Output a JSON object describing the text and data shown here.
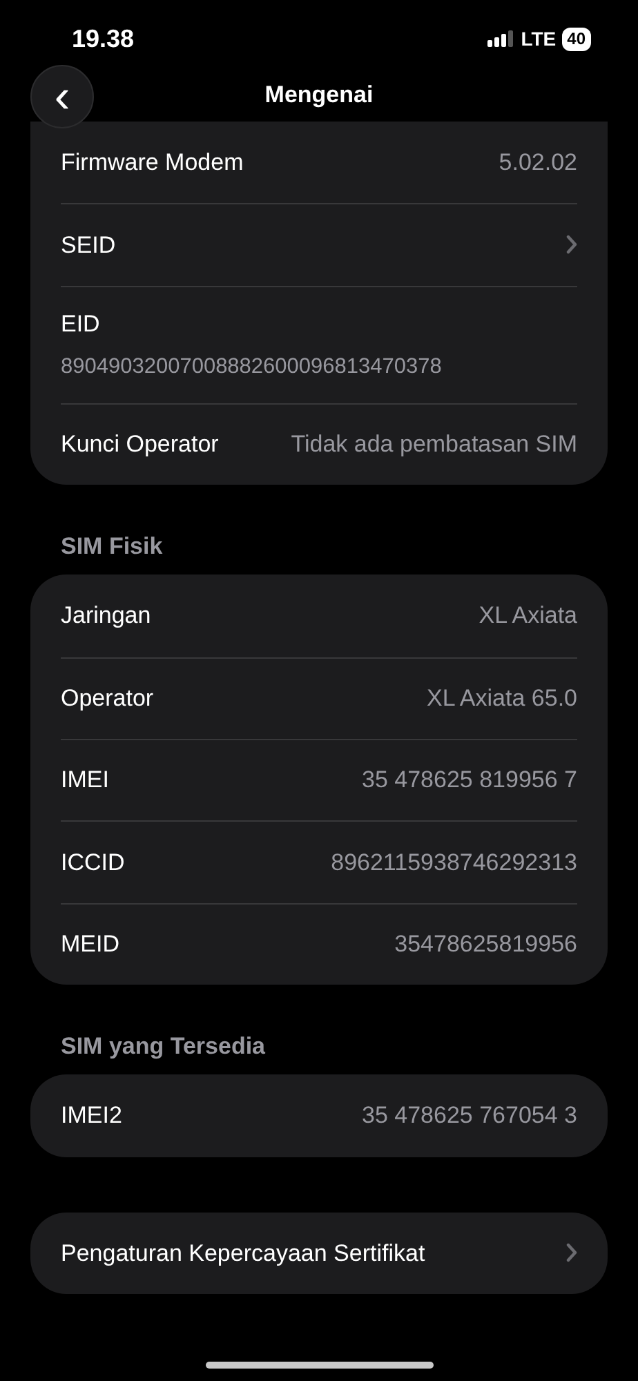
{
  "status_bar": {
    "time": "19.38",
    "network": "LTE",
    "battery": "40"
  },
  "nav": {
    "back": "‹",
    "title": "Mengenai"
  },
  "sections": [
    {
      "clipped_top": true,
      "rows": [
        {
          "kind": "value",
          "label": "Firmware Modem",
          "value": "5.02.02"
        },
        {
          "kind": "link",
          "label": "SEID"
        },
        {
          "kind": "stacked",
          "label": "EID",
          "value": "89049032007008882600096813470378"
        },
        {
          "kind": "value",
          "label": "Kunci Operator",
          "value": "Tidak ada pembatasan SIM"
        }
      ]
    },
    {
      "header": "SIM Fisik",
      "rows": [
        {
          "kind": "value",
          "label": "Jaringan",
          "value": "XL Axiata"
        },
        {
          "kind": "value",
          "label": "Operator",
          "value": "XL Axiata 65.0"
        },
        {
          "kind": "value",
          "label": "IMEI",
          "value": "35 478625 819956 7"
        },
        {
          "kind": "value",
          "label": "ICCID",
          "value": "8962115938746292313"
        },
        {
          "kind": "value",
          "label": "MEID",
          "value": "35478625819956"
        }
      ]
    },
    {
      "header": "SIM yang Tersedia",
      "rows": [
        {
          "kind": "value",
          "label": "IMEI2",
          "value": "35 478625 767054 3"
        }
      ]
    },
    {
      "rows": [
        {
          "kind": "link",
          "label": "Pengaturan Kepercayaan Sertifikat"
        }
      ]
    }
  ]
}
